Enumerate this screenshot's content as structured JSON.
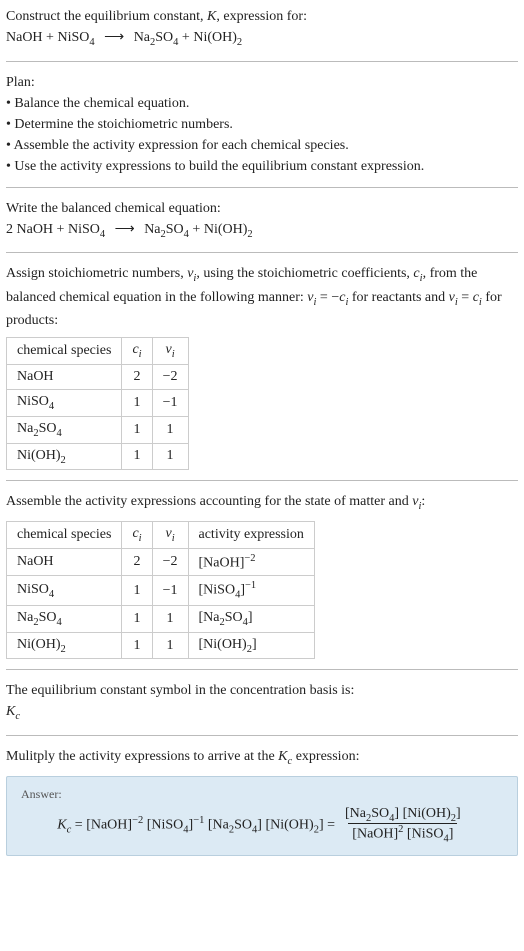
{
  "intro": {
    "line1_prefix": "Construct the equilibrium constant, ",
    "line1_K": "K",
    "line1_suffix": ", expression for:",
    "eq_lhs_1": "NaOH",
    "plus": " + ",
    "eq_lhs_2": "NiSO",
    "eq_lhs_2_sub": "4",
    "arrow": "⟶",
    "eq_rhs_1": "Na",
    "eq_rhs_1_sub1": "2",
    "eq_rhs_1_mid": "SO",
    "eq_rhs_1_sub2": "4",
    "eq_rhs_2": "Ni(OH)",
    "eq_rhs_2_sub": "2"
  },
  "plan": {
    "heading": "Plan:",
    "b1": "• Balance the chemical equation.",
    "b2": "• Determine the stoichiometric numbers.",
    "b3": "• Assemble the activity expression for each chemical species.",
    "b4": "• Use the activity expressions to build the equilibrium constant expression."
  },
  "balanced": {
    "heading": "Write the balanced chemical equation:",
    "coef1": "2 ",
    "sp1": "NaOH",
    "sp2": "NiSO",
    "sp2_sub": "4",
    "sp3a": "Na",
    "sp3_sub1": "2",
    "sp3b": "SO",
    "sp3_sub2": "4",
    "sp4": "Ni(OH)",
    "sp4_sub": "2"
  },
  "assign": {
    "text1": "Assign stoichiometric numbers, ",
    "nu_i": "ν",
    "nu_sub": "i",
    "text2": ", using the stoichiometric coefficients, ",
    "c_i": "c",
    "c_sub": "i",
    "text3": ", from the balanced chemical equation in the following manner: ",
    "rel1a": "ν",
    "rel1b": " = −",
    "rel1c": "c",
    "text4": " for reactants and ",
    "rel2a": "ν",
    "rel2b": " = ",
    "rel2c": "c",
    "text5": " for products:"
  },
  "table1": {
    "h1": "chemical species",
    "h2": "c",
    "h2_sub": "i",
    "h3": "ν",
    "h3_sub": "i",
    "r1c1": "NaOH",
    "r1c2": "2",
    "r1c3": "−2",
    "r2c1": "NiSO",
    "r2c1_sub": "4",
    "r2c2": "1",
    "r2c3": "−1",
    "r3c1a": "Na",
    "r3c1_s1": "2",
    "r3c1b": "SO",
    "r3c1_s2": "4",
    "r3c2": "1",
    "r3c3": "1",
    "r4c1": "Ni(OH)",
    "r4c1_sub": "2",
    "r4c2": "1",
    "r4c3": "1"
  },
  "assemble": {
    "text1": "Assemble the activity expressions accounting for the state of matter and ",
    "nu": "ν",
    "nu_sub": "i",
    "text2": ":"
  },
  "table2": {
    "h1": "chemical species",
    "h2": "c",
    "h2_sub": "i",
    "h3": "ν",
    "h3_sub": "i",
    "h4": "activity expression",
    "r1c1": "NaOH",
    "r1c2": "2",
    "r1c3": "−2",
    "r1c4a": "[NaOH]",
    "r1c4_sup": "−2",
    "r2c1": "NiSO",
    "r2c1_sub": "4",
    "r2c2": "1",
    "r2c3": "−1",
    "r2c4a": "[NiSO",
    "r2c4_sub": "4",
    "r2c4b": "]",
    "r2c4_sup": "−1",
    "r3c1a": "Na",
    "r3c1_s1": "2",
    "r3c1b": "SO",
    "r3c1_s2": "4",
    "r3c2": "1",
    "r3c3": "1",
    "r3c4a": "[Na",
    "r3c4_s1": "2",
    "r3c4b": "SO",
    "r3c4_s2": "4",
    "r3c4c": "]",
    "r4c1": "Ni(OH)",
    "r4c1_sub": "2",
    "r4c2": "1",
    "r4c3": "1",
    "r4c4a": "[Ni(OH)",
    "r4c4_sub": "2",
    "r4c4b": "]"
  },
  "eqconst": {
    "line1": "The equilibrium constant symbol in the concentration basis is:",
    "K": "K",
    "K_sub": "c"
  },
  "mult": {
    "text1": "Mulitply the activity expressions to arrive at the ",
    "K": "K",
    "K_sub": "c",
    "text2": " expression:"
  },
  "answer": {
    "label": "Answer:",
    "K": "K",
    "K_sub": "c",
    "eq": " = ",
    "t1": "[NaOH]",
    "t1_sup": "−2",
    "t2a": " [NiSO",
    "t2_sub": "4",
    "t2b": "]",
    "t2_sup": "−1",
    "t3a": " [Na",
    "t3_s1": "2",
    "t3b": "SO",
    "t3_s2": "4",
    "t3c": "]",
    "t4a": " [Ni(OH)",
    "t4_sub": "2",
    "t4b": "] = ",
    "num1a": "[Na",
    "num1_s1": "2",
    "num1b": "SO",
    "num1_s2": "4",
    "num1c": "]",
    "num2a": " [Ni(OH)",
    "num2_sub": "2",
    "num2b": "]",
    "den1": "[NaOH]",
    "den1_sup": "2",
    "den2a": " [NiSO",
    "den2_sub": "4",
    "den2b": "]"
  }
}
